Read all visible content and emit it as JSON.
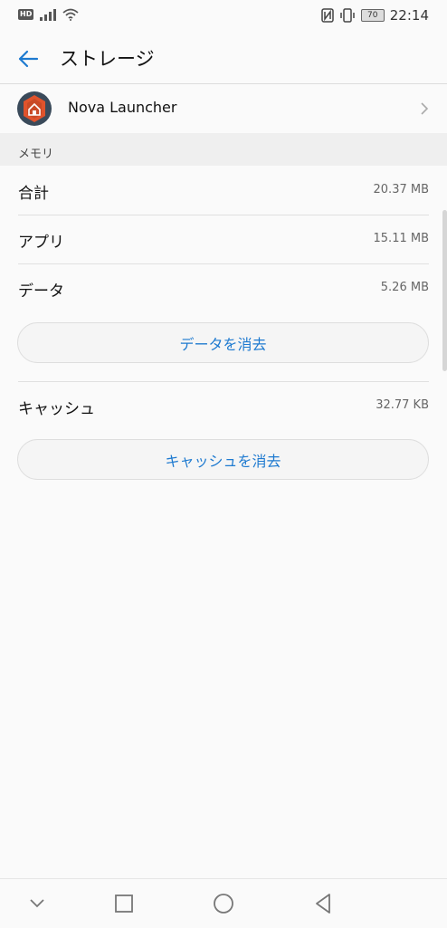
{
  "status_bar": {
    "hd_label": "HD",
    "battery_level": "70",
    "time": "22:14"
  },
  "app_bar": {
    "title": "ストレージ"
  },
  "app": {
    "name": "Nova Launcher"
  },
  "memory": {
    "section_label": "メモリ",
    "rows": [
      {
        "label": "合計",
        "value": "20.37 MB"
      },
      {
        "label": "アプリ",
        "value": "15.11 MB"
      },
      {
        "label": "データ",
        "value": "5.26 MB"
      }
    ],
    "clear_data_label": "データを消去"
  },
  "cache": {
    "label": "キャッシュ",
    "value": "32.77 KB",
    "clear_cache_label": "キャッシュを消去"
  },
  "colors": {
    "accent": "#1e7ad0",
    "background": "#fafafa",
    "section_bg": "#efefef"
  },
  "icons": {
    "back": "arrow-left-icon",
    "chevron": "chevron-right-icon",
    "nav_down": "chevron-down-icon",
    "nav_recent": "square-icon",
    "nav_home": "circle-icon",
    "nav_back": "triangle-back-icon"
  }
}
